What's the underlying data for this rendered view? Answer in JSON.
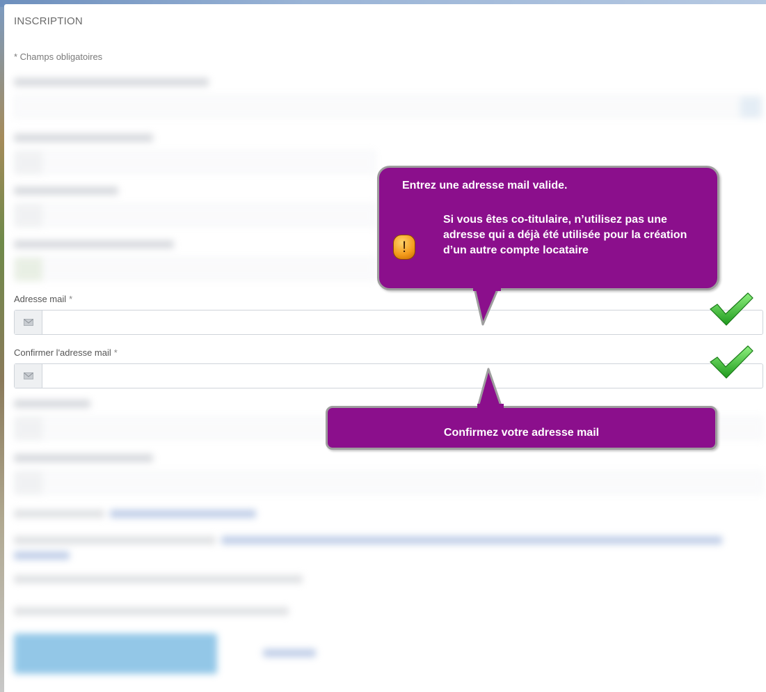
{
  "form": {
    "title": "INSCRIPTION",
    "required_note": "* Champs obligatoires",
    "email_label": "Adresse mail",
    "confirm_email_label": "Confirmer l'adresse mail",
    "required_mark": "*",
    "email_value": "",
    "confirm_email_value": ""
  },
  "callouts": {
    "email_hint_title": "Entrez une adresse mail valide.",
    "email_hint_body": "Si vous êtes co-titulaire, n’utilisez pas une adresse qui a  déjà été utilisée pour  la création d’un autre compte locataire",
    "warning_glyph": "!",
    "confirm_hint": "Confirmez votre adresse mail"
  },
  "icons": {
    "field_prefix": "mail-icon",
    "validation": "check-icon",
    "warning": "warning-icon"
  },
  "colors": {
    "callout_fill": "#8b0f8c",
    "callout_border": "#9e9e9e",
    "check_green": "#2fbf2a",
    "warning_orange": "#f39a1a"
  }
}
